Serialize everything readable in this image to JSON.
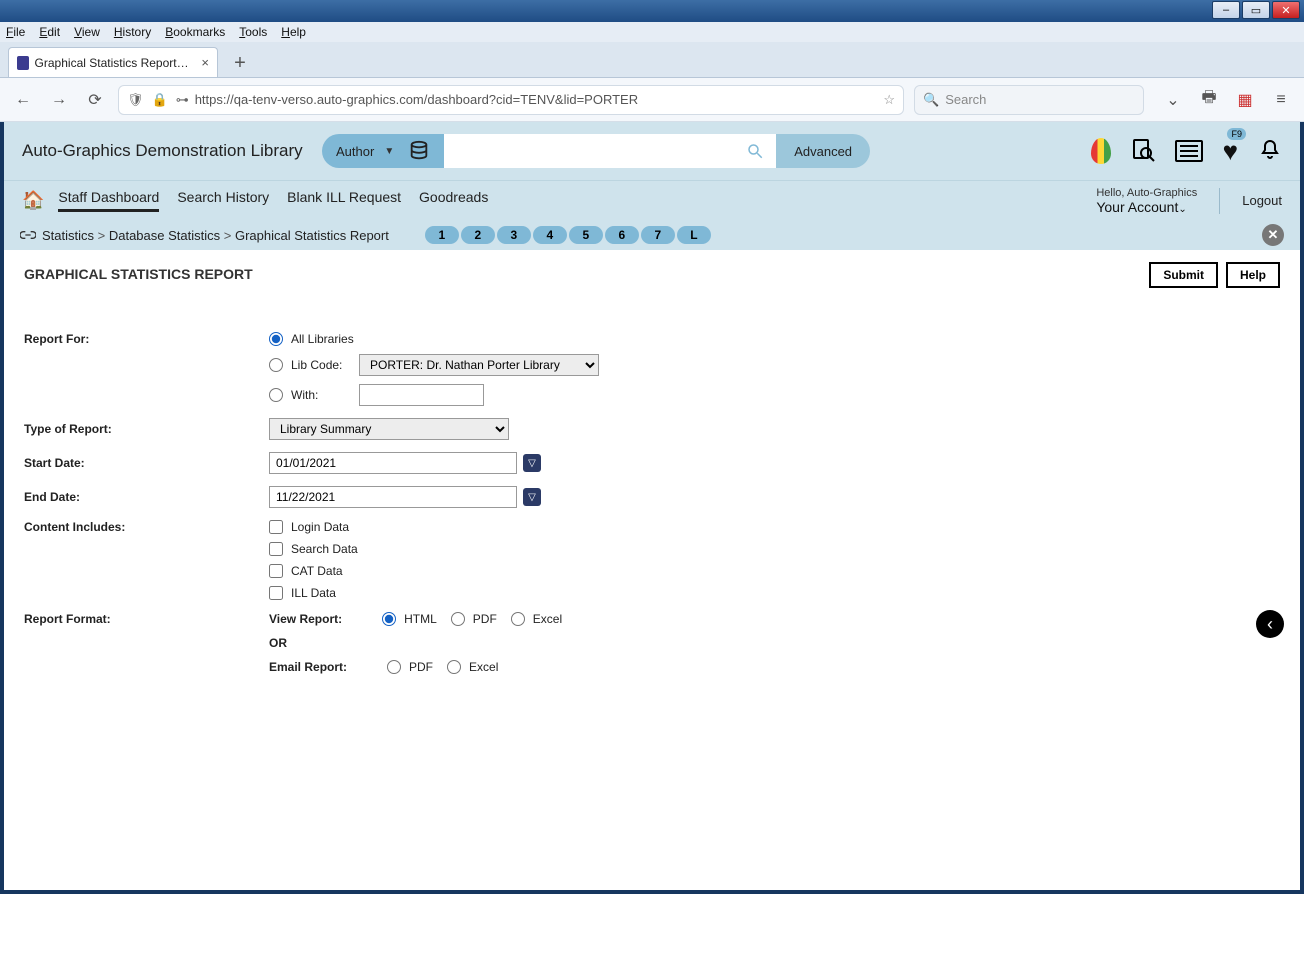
{
  "browser": {
    "menus": [
      "File",
      "Edit",
      "View",
      "History",
      "Bookmarks",
      "Tools",
      "Help"
    ],
    "tab_title": "Graphical Statistics Report | TEN…",
    "url": "https://qa-tenv-verso.auto-graphics.com/dashboard?cid=TENV&lid=PORTER",
    "url_bold_start": "auto-graphics.com",
    "search_placeholder": "Search"
  },
  "header": {
    "brand": "Auto-Graphics Demonstration Library",
    "search_category": "Author",
    "advanced": "Advanced",
    "hello": "Hello, Auto-Graphics",
    "your_account": "Your Account",
    "logout": "Logout",
    "wishlist_badge": "F9",
    "nav": [
      "Staff Dashboard",
      "Search History",
      "Blank ILL Request",
      "Goodreads"
    ],
    "nav_active_index": 0
  },
  "breadcrumb": {
    "items": [
      "Statistics",
      "Database Statistics",
      "Graphical Statistics Report"
    ],
    "pages": [
      "1",
      "2",
      "3",
      "4",
      "5",
      "6",
      "7",
      "L"
    ]
  },
  "page": {
    "title": "GRAPHICAL STATISTICS REPORT",
    "submit": "Submit",
    "help": "Help"
  },
  "form": {
    "report_for_label": "Report For:",
    "report_for_options": {
      "all_libraries": "All Libraries",
      "lib_code": "Lib Code:",
      "with": "With:"
    },
    "lib_code_select": "PORTER: Dr. Nathan Porter Library",
    "report_for_selected": "all_libraries",
    "type_label": "Type of Report:",
    "type_select": "Library Summary",
    "start_date_label": "Start Date:",
    "start_date": "01/01/2021",
    "end_date_label": "End Date:",
    "end_date": "11/22/2021",
    "content_label": "Content Includes:",
    "content_options": [
      "Login Data",
      "Search Data",
      "CAT Data",
      "ILL Data"
    ],
    "format_label": "Report Format:",
    "view_report_label": "View Report:",
    "view_options": [
      "HTML",
      "PDF",
      "Excel"
    ],
    "view_selected_index": 0,
    "or_label": "OR",
    "email_report_label": "Email Report:",
    "email_options": [
      "PDF",
      "Excel"
    ]
  }
}
